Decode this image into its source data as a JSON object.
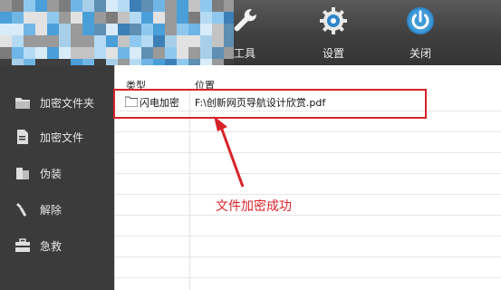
{
  "toolbar": {
    "items": [
      {
        "label": "工具",
        "icon": "wrench-icon"
      },
      {
        "label": "设置",
        "icon": "gear-icon"
      },
      {
        "label": "关闭",
        "icon": "power-icon"
      }
    ]
  },
  "sidebar": {
    "items": [
      {
        "label": "加密文件夹",
        "icon": "folder-icon"
      },
      {
        "label": "加密文件",
        "icon": "file-icon"
      },
      {
        "label": "伪装",
        "icon": "disguise-icon"
      },
      {
        "label": "解除",
        "icon": "unlock-icon"
      },
      {
        "label": "急救",
        "icon": "first-aid-icon"
      }
    ]
  },
  "list": {
    "columns": {
      "type": "类型",
      "location": "位置"
    },
    "rows": [
      {
        "type": "闪电加密",
        "location": "F:\\创新网页导航设计欣赏.pdf"
      }
    ]
  },
  "annotation": {
    "text": "文件加密成功"
  },
  "colors": {
    "annotation_red": "#d8232a",
    "toolbar_dark": "#3f3f3f",
    "icon_blue": "#2f86c8"
  }
}
